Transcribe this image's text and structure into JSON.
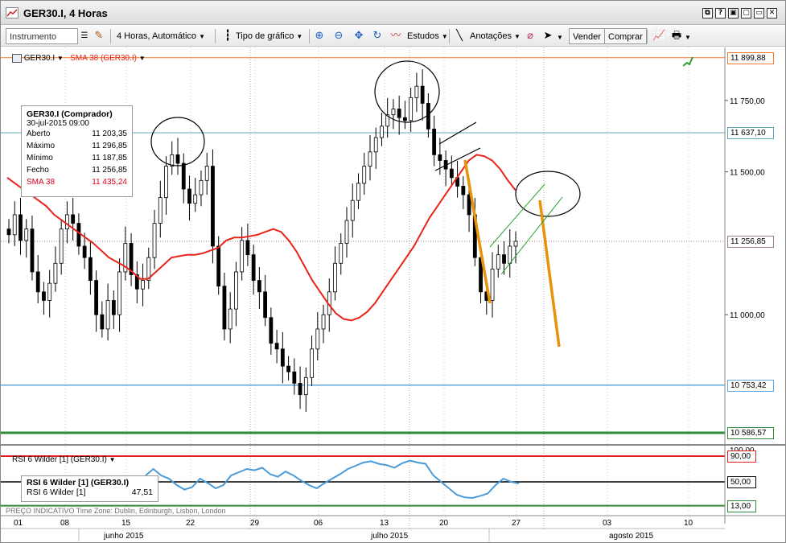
{
  "window": {
    "title": "GER30.I, 4 Horas",
    "controls": [
      "⧉",
      "?",
      "▣",
      "▢",
      "▭",
      "✕"
    ]
  },
  "toolbar": {
    "instrument_placeholder": "Instrumento",
    "timeframe": "4 Horas, Automático",
    "chart_type": "Tipo de gráfico",
    "studies": "Estudos",
    "annotations": "Anotações",
    "sell": "Vender",
    "buy": "Comprar"
  },
  "legend": {
    "symbol": "GER30.I",
    "sma": "SMA 38 (GER30.I)",
    "rsi": "RSI 6 Wilder [1] (GER30.I)"
  },
  "infobox": {
    "title": "GER30.I (Comprador)",
    "datetime": "30-jul-2015 09:00",
    "rows": [
      {
        "label": "Aberto",
        "value": "11 203,35"
      },
      {
        "label": "Máximo",
        "value": "11 296,85"
      },
      {
        "label": "Mínimo",
        "value": "11 187,85"
      },
      {
        "label": "Fecho",
        "value": "11 256,85"
      }
    ],
    "sma_label": "SMA 38",
    "sma_value": "11 435,24"
  },
  "rsi_info": {
    "title": "RSI 6 Wilder [1] (GER30.I)",
    "label": "RSI 6 Wilder [1]",
    "value": "47,51"
  },
  "footer": "PREÇO INDICATIVO    Time Zone: Dublin, Edinburgh, Lisbon, London",
  "price_axis": {
    "ticks": [
      "11 750,00",
      "11 500,00",
      "11 000,00"
    ],
    "tags": [
      {
        "text": "11 899,88",
        "price": 11899.88,
        "color": "#f07a2a"
      },
      {
        "text": "11 637,10",
        "price": 11637.1,
        "color": "#5fa8b8"
      },
      {
        "text": "11 256,85",
        "price": 11256.85,
        "color": "#a08080"
      },
      {
        "text": "10 753,42",
        "price": 10753.42,
        "color": "#5aa8e6"
      },
      {
        "text": "10 586,57",
        "price": 10586.57,
        "color": "#2e8b3a"
      }
    ]
  },
  "rsi_axis": {
    "ticks": [
      "100,00",
      "90,00",
      "50,00",
      "13,00"
    ],
    "levels": [
      90,
      50,
      13
    ]
  },
  "time_axis": {
    "days": [
      "01",
      "08",
      "15",
      "22",
      "29",
      "06",
      "13",
      "20",
      "27",
      "03",
      "10"
    ],
    "months": [
      "junho 2015",
      "julho 2015",
      "agosto 2015"
    ]
  },
  "colors": {
    "sma": "#e8231a",
    "candle": "#000000",
    "rsi": "#4a9ad8",
    "trend_orange": "#e8930a",
    "channel_green": "#2ea02e"
  },
  "chart_data": {
    "type": "candlestick",
    "symbol": "GER30.I",
    "timeframe": "4 Horas",
    "ylim": [
      10550,
      11930
    ],
    "rsi_range": [
      0,
      100
    ],
    "last_candle": {
      "open": 11203.35,
      "high": 11296.85,
      "low": 11187.85,
      "close": 11256.85,
      "date": "30-jul-2015 09:00"
    },
    "sma38_last": 11435.24,
    "rsi_last": 47.51,
    "closes": [
      11280,
      11350,
      11260,
      11300,
      11150,
      11080,
      11050,
      11110,
      11180,
      11300,
      11350,
      11320,
      11240,
      11200,
      11120,
      11000,
      10950,
      11050,
      11000,
      11150,
      11250,
      11140,
      11090,
      11120,
      11200,
      11320,
      11410,
      11520,
      11560,
      11530,
      11440,
      11390,
      11420,
      11470,
      11520,
      11240,
      11100,
      10950,
      11020,
      11150,
      11260,
      11210,
      11120,
      11080,
      10990,
      10900,
      10880,
      10820,
      10800,
      10760,
      10720,
      10780,
      10880,
      10950,
      11000,
      11080,
      11180,
      11250,
      11330,
      11400,
      11460,
      11520,
      11570,
      11620,
      11660,
      11700,
      11720,
      11690,
      11680,
      11760,
      11800,
      11740,
      11650,
      11560,
      11540,
      11510,
      11480,
      11450,
      11420,
      11350,
      11200,
      11080,
      11050,
      11160,
      11210,
      11180,
      11240,
      11256.85
    ],
    "sma38": [
      11480,
      11460,
      11440,
      11420,
      11400,
      11380,
      11350,
      11330,
      11310,
      11290,
      11270,
      11250,
      11225,
      11200,
      11185,
      11170,
      11150,
      11125,
      11125,
      11150,
      11175,
      11200,
      11205,
      11210,
      11210,
      11215,
      11225,
      11235,
      11260,
      11270,
      11270,
      11275,
      11280,
      11290,
      11300,
      11290,
      11260,
      11220,
      11170,
      11120,
      11080,
      11040,
      11005,
      10985,
      10980,
      10990,
      11010,
      11040,
      11080,
      11120,
      11160,
      11200,
      11240,
      11290,
      11340,
      11380,
      11420,
      11460,
      11500,
      11540,
      11560,
      11555,
      11540,
      11510,
      11470,
      11435.24
    ],
    "rsi6": [
      60,
      70,
      60,
      55,
      45,
      38,
      42,
      55,
      48,
      40,
      45,
      60,
      65,
      70,
      68,
      72,
      62,
      58,
      66,
      60,
      52,
      45,
      40,
      48,
      55,
      62,
      70,
      75,
      80,
      82,
      78,
      76,
      72,
      79,
      83,
      80,
      78,
      60,
      50,
      40,
      30,
      26,
      25,
      28,
      32,
      45,
      55,
      50,
      47.51
    ],
    "annotations": {
      "ellipses": 4,
      "orange_trendlines": 2,
      "green_channel": true,
      "black_lines": 2
    }
  }
}
